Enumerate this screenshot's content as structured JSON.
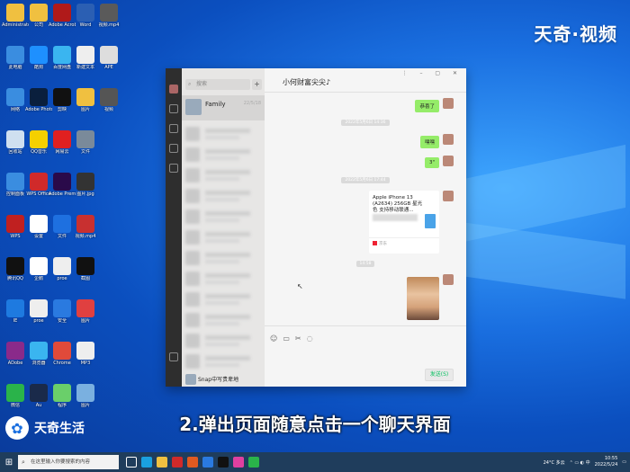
{
  "watermark": "天奇·视频",
  "brand": "天奇生活",
  "subtitle": "2.弹出页面随意点击一个聊天界面",
  "desktop_icons": [
    {
      "label": "Administrator",
      "color": "#f0c040"
    },
    {
      "label": "公司",
      "color": "#f0c040"
    },
    {
      "label": "Adobe Acrobat",
      "color": "#b01a1a"
    },
    {
      "label": "Word",
      "color": "#2b5fb3"
    },
    {
      "label": "视频.mp4",
      "color": "#5a5a5a"
    },
    {
      "label": "此电脑",
      "color": "#3a8de0"
    },
    {
      "label": "酷狗",
      "color": "#1e90ff"
    },
    {
      "label": "百度网盘",
      "color": "#3ab5f0"
    },
    {
      "label": "新建文本",
      "color": "#eeeeee"
    },
    {
      "label": "APE",
      "color": "#dddddd"
    },
    {
      "label": "网络",
      "color": "#3a8de0"
    },
    {
      "label": "Adobe Photoshop",
      "color": "#0a1f3d"
    },
    {
      "label": "剪映",
      "color": "#111111"
    },
    {
      "label": "图片",
      "color": "#f0c040"
    },
    {
      "label": "视频",
      "color": "#555555"
    },
    {
      "label": "回收站",
      "color": "#cfe0f0"
    },
    {
      "label": "QQ音乐",
      "color": "#f5d000"
    },
    {
      "label": "网易云",
      "color": "#e02020"
    },
    {
      "label": "文件",
      "color": "#7a8a9a"
    },
    {
      "label": "控制面板",
      "color": "#3a8de0"
    },
    {
      "label": "WPS Office",
      "color": "#d02a2a"
    },
    {
      "label": "Adobe Premiere",
      "color": "#2a0a4a"
    },
    {
      "label": "图片.jpg",
      "color": "#333333"
    },
    {
      "label": "WPS",
      "color": "#c02020"
    },
    {
      "label": "设置",
      "color": "#ffffff"
    },
    {
      "label": "文件",
      "color": "#1e70e0"
    },
    {
      "label": "视频.mp4",
      "color": "#c83030"
    },
    {
      "label": "腾讯QQ",
      "color": "#111111"
    },
    {
      "label": "企鹅",
      "color": "#ffffff"
    },
    {
      "label": "proe",
      "color": "#eeeeee"
    },
    {
      "label": "截图",
      "color": "#111111"
    },
    {
      "label": "IE",
      "color": "#1e7ae0"
    },
    {
      "label": "proe",
      "color": "#eeeeee"
    },
    {
      "label": "安全",
      "color": "#2a7ae0"
    },
    {
      "label": "图片",
      "color": "#e04040"
    },
    {
      "label": "ADobe",
      "color": "#8a2a8a"
    },
    {
      "label": "浏览器",
      "color": "#3ab5f0"
    },
    {
      "label": "Chrome",
      "color": "#e04a3a"
    },
    {
      "label": "MP3",
      "color": "#eeeeee"
    },
    {
      "label": "微信",
      "color": "#2ab34a"
    },
    {
      "label": "Au",
      "color": "#1a2a4a"
    },
    {
      "label": "程序",
      "color": "#6acf6a"
    },
    {
      "label": "图片",
      "color": "#7ab0e0"
    }
  ],
  "wechat": {
    "search_placeholder": "搜索",
    "plus": "+",
    "contact_name": "Family",
    "contact_time": "22/5/18",
    "bottom_contact": "Snap中写贵卑地",
    "chat_title": "小何财富尖尖♪",
    "messages": [
      "恭喜了",
      "嘿嘿",
      "3\""
    ],
    "timestamps": [
      "2022年5月6日 14:36",
      "2022年5月6日 17:44",
      "14:58"
    ],
    "product_title": "Apple iPhone 13 (A2634) 256GB 星光色 支持移动联通...",
    "product_source": "京东",
    "send": "发送(S)"
  },
  "taskbar": {
    "search_placeholder": "在这里输入你要搜索的内容",
    "weather": "24°C 多云",
    "time": "10:55",
    "date": "2022/5/24"
  }
}
